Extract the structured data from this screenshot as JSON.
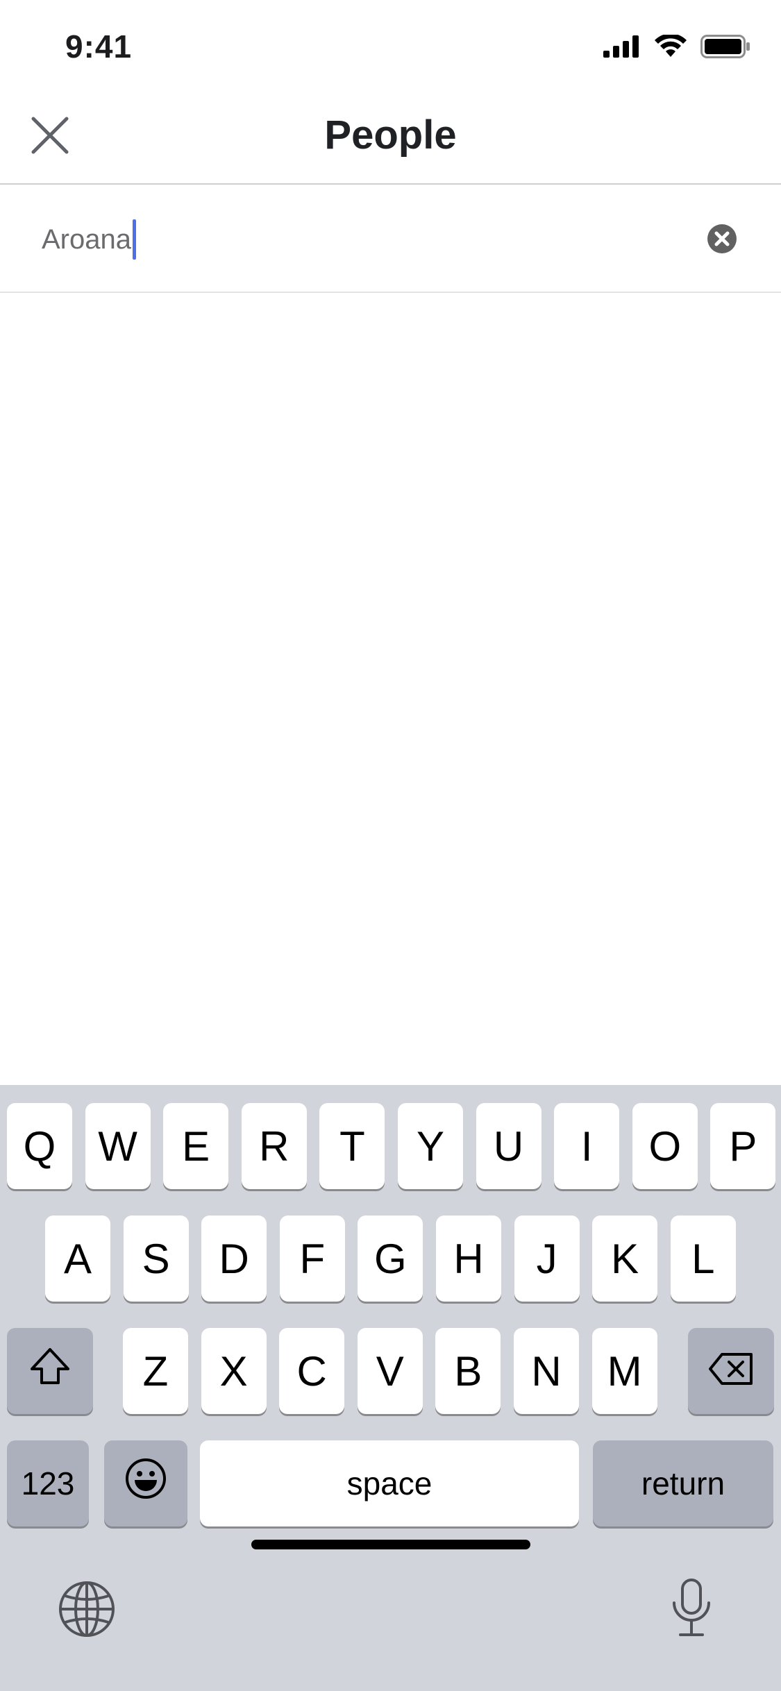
{
  "status_bar": {
    "time": "9:41",
    "icons": [
      "cellular-signal-icon",
      "wifi-icon",
      "battery-icon"
    ]
  },
  "nav": {
    "title": "People",
    "close_icon": "close-icon"
  },
  "search": {
    "value": "Aroana",
    "clear_icon": "clear-circle-icon",
    "caret_color": "#4f6fe8"
  },
  "keyboard": {
    "row1": [
      "Q",
      "W",
      "E",
      "R",
      "T",
      "Y",
      "U",
      "I",
      "O",
      "P"
    ],
    "row2": [
      "A",
      "S",
      "D",
      "F",
      "G",
      "H",
      "J",
      "K",
      "L"
    ],
    "row3": [
      "Z",
      "X",
      "C",
      "V",
      "B",
      "N",
      "M"
    ],
    "numbers_label": "123",
    "space_label": "space",
    "return_label": "return",
    "icons": [
      "shift-icon",
      "backspace-icon",
      "emoji-icon",
      "globe-icon",
      "microphone-icon"
    ]
  },
  "colors": {
    "keyboard_bg": "#d1d4db",
    "function_key": "#abb0bc",
    "letter_key": "#ffffff"
  }
}
